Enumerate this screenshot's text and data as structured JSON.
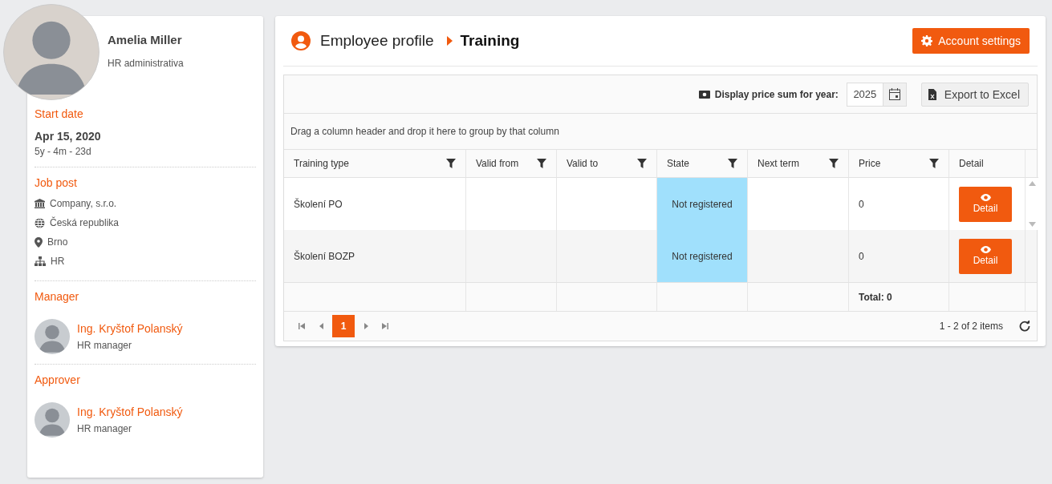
{
  "profile": {
    "name": "Amelia Miller",
    "role": "HR administrativa",
    "start": {
      "label": "Start date",
      "date": "Apr 15, 2020",
      "tenure": "5y - 4m - 23d"
    },
    "job_post": {
      "label": "Job post",
      "items": [
        {
          "kind": "company",
          "text": "Company, s.r.o."
        },
        {
          "kind": "country",
          "text": "Česká republika"
        },
        {
          "kind": "city",
          "text": "Brno"
        },
        {
          "kind": "department",
          "text": "HR"
        }
      ]
    },
    "people": [
      {
        "label": "Manager",
        "name": "Ing. Kryštof Polanský",
        "role": "HR manager"
      },
      {
        "label": "Approver",
        "name": "Ing. Kryštof Polanský",
        "role": "HR manager"
      }
    ]
  },
  "breadcrumb": [
    "Employee profile",
    "Training"
  ],
  "account_button": "Account settings",
  "toolbar": {
    "price_label": "Display price sum for year:",
    "year": "2025",
    "export": "Export to Excel"
  },
  "group_hint": "Drag a column header and drop it here to group by that column",
  "table": {
    "columns": [
      {
        "label": "Training type",
        "filter": true
      },
      {
        "label": "Valid from",
        "filter": true
      },
      {
        "label": "Valid to",
        "filter": true
      },
      {
        "label": "State",
        "filter": true
      },
      {
        "label": "Next term",
        "filter": true
      },
      {
        "label": "Price",
        "filter": true
      },
      {
        "label": "Detail",
        "filter": false
      }
    ],
    "rows": [
      {
        "training_type": "Školení PO",
        "state": "Not registered",
        "state_highlighted": true,
        "price": "0",
        "detail": "Detail"
      },
      {
        "training_type": "Školení BOZP",
        "state": "Not registered",
        "state_highlighted": true,
        "price": "0",
        "detail": "Detail"
      }
    ],
    "footer_total": "Total: 0"
  },
  "pager": {
    "pages": [
      {
        "label": "1",
        "selected": true
      }
    ],
    "info": "1 - 2 of 2 items"
  }
}
